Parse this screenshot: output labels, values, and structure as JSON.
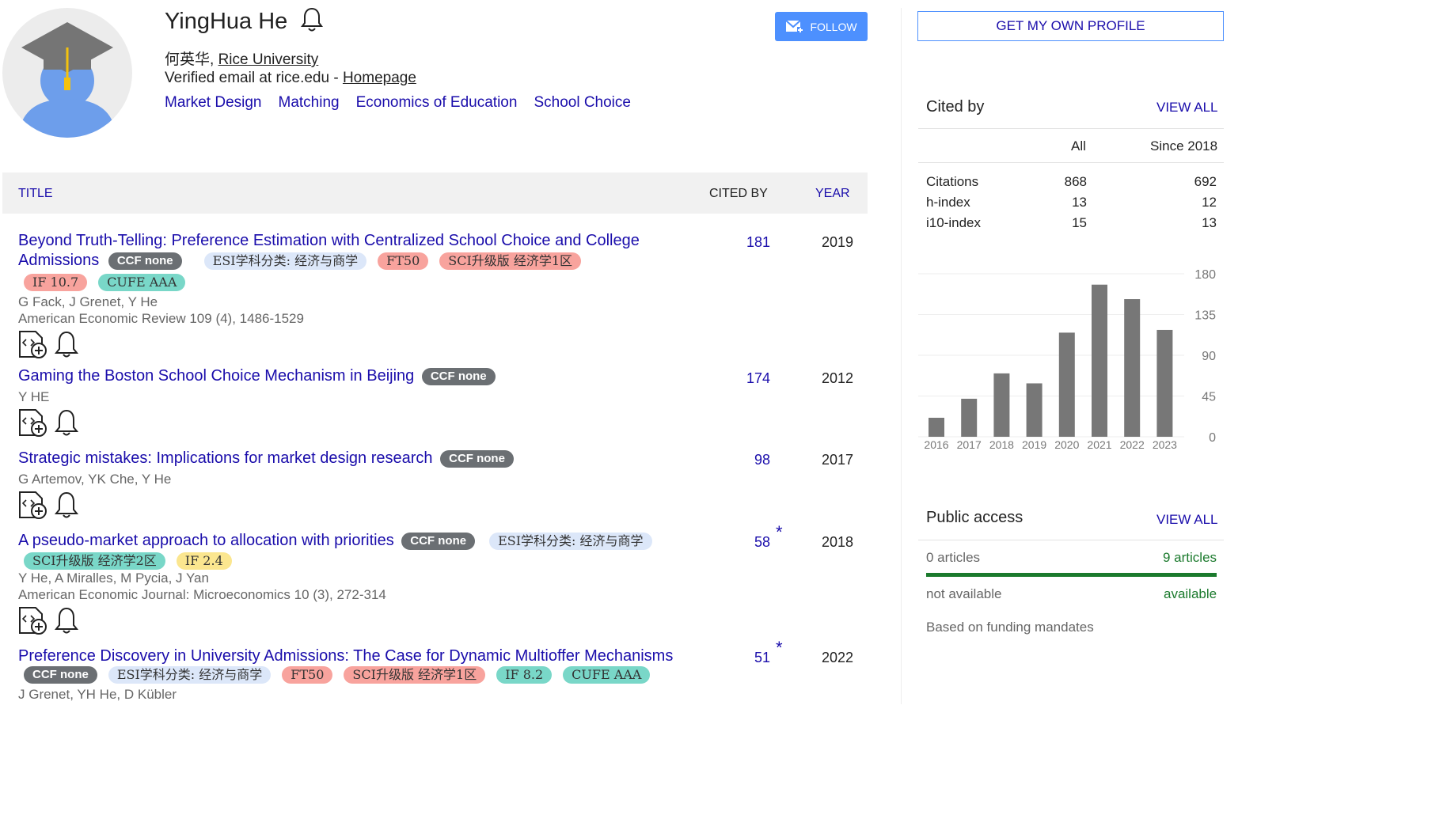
{
  "profile": {
    "name": "YingHua He",
    "affiliation_prefix": "何英华, ",
    "affiliation": "Rice University",
    "email_text": "Verified email at rice.edu - ",
    "homepage": "Homepage",
    "interests": [
      "Market Design",
      "Matching",
      "Economics of Education",
      "School Choice"
    ],
    "follow_label": "FOLLOW"
  },
  "table": {
    "col_title": "TITLE",
    "col_cited": "CITED BY",
    "col_year": "YEAR"
  },
  "articles": [
    {
      "title_a": "Beyond Truth-Telling: Preference Estimation with Centralized School Choice and College",
      "title_b": "Admissions",
      "badges": {
        "ccf": "CCF none",
        "esi": "ESI学科分类: 经济与商学",
        "ft": "FT50",
        "sci": "SCI升级版 经济学1区",
        "if": "IF 10.7",
        "cufe": "CUFE AAA"
      },
      "authors": "G Fack, J Grenet, Y He",
      "venue": "American Economic Review 109 (4), 1486-1529",
      "cited": "181",
      "year": "2019"
    },
    {
      "title": "Gaming the Boston School Choice Mechanism in Beijing",
      "badges": {
        "ccf": "CCF none"
      },
      "authors": "Y HE",
      "cited": "174",
      "year": "2012"
    },
    {
      "title": "Strategic mistakes: Implications for market design research",
      "badges": {
        "ccf": "CCF none"
      },
      "authors": "G Artemov, YK Che, Y He",
      "cited": "98",
      "year": "2017"
    },
    {
      "title": "A pseudo-market approach to allocation with priorities",
      "badges": {
        "ccf": "CCF none",
        "esi": "ESI学科分类: 经济与商学",
        "sci": "SCI升级版 经济学2区",
        "if": "IF 2.4"
      },
      "authors": "Y He, A Miralles, M Pycia, J Yan",
      "venue": "American Economic Journal: Microeconomics 10 (3), 272-314",
      "cited": "58",
      "star": "*",
      "year": "2018"
    },
    {
      "title": "Preference Discovery in University Admissions: The Case for Dynamic Multioffer Mechanisms",
      "badges": {
        "ccf": "CCF none",
        "esi": "ESI学科分类: 经济与商学",
        "ft": "FT50",
        "sci": "SCI升级版 经济学1区",
        "if": "IF 8.2",
        "cufe": "CUFE AAA"
      },
      "authors": "J Grenet, YH He, D Kübler",
      "cited": "51",
      "star": "*",
      "year": "2022"
    }
  ],
  "sidebar": {
    "own_profile_label": "GET MY OWN PROFILE",
    "cited_by_title": "Cited by",
    "view_all": "VIEW ALL",
    "col_all": "All",
    "col_since": "Since 2018",
    "rows": [
      {
        "label": "Citations",
        "all": "868",
        "since": "692"
      },
      {
        "label": "h-index",
        "all": "13",
        "since": "12"
      },
      {
        "label": "i10-index",
        "all": "15",
        "since": "13"
      }
    ],
    "public_access_title": "Public access",
    "pa_left": "0 articles",
    "pa_right": "9 articles",
    "pa_left_sub": "not available",
    "pa_right_sub": "available",
    "pa_note": "Based on funding mandates"
  },
  "chart_data": {
    "type": "bar",
    "categories": [
      "2016",
      "2017",
      "2018",
      "2019",
      "2020",
      "2021",
      "2022",
      "2023"
    ],
    "values": [
      21,
      42,
      70,
      59,
      115,
      168,
      152,
      118
    ],
    "ylim": [
      0,
      180
    ],
    "yticks": [
      "0",
      "45",
      "90",
      "135",
      "180"
    ],
    "color": "#777777"
  }
}
